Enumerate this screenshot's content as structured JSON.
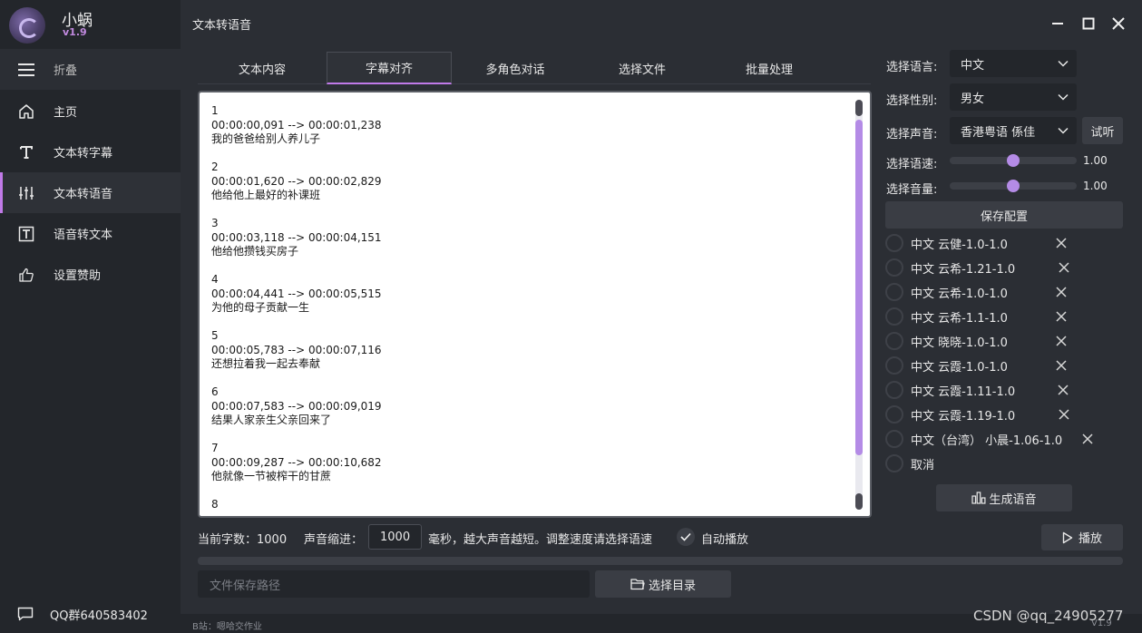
{
  "app": {
    "name": "小蜗",
    "version": "v1.9",
    "window_title": "文本转语音"
  },
  "sidebar": {
    "collapse_label": "折叠",
    "items": [
      {
        "label": "主页",
        "icon": "home-icon"
      },
      {
        "label": "文本转字幕",
        "icon": "text-t-icon"
      },
      {
        "label": "文本转语音",
        "icon": "sliders-icon",
        "active": true
      },
      {
        "label": "语音转文本",
        "icon": "text-box-icon"
      },
      {
        "label": "设置赞助",
        "icon": "thumbs-up-icon"
      }
    ],
    "qq_group": "QQ群640583402"
  },
  "tabs": [
    "文本内容",
    "字幕对齐",
    "多角色对话",
    "选择文件",
    "批量处理"
  ],
  "active_tab": "字幕对齐",
  "editor": {
    "text": "1\n00:00:00,091 --> 00:00:01,238\n我的爸爸给别人养儿子\n\n2\n00:00:01,620 --> 00:00:02,829\n他给他上最好的补课班\n\n3\n00:00:03,118 --> 00:00:04,151\n他给他攒钱买房子\n\n4\n00:00:04,441 --> 00:00:05,515\n为他的母子贡献一生\n\n5\n00:00:05,783 --> 00:00:07,116\n还想拉着我一起去奉献\n\n6\n00:00:07,583 --> 00:00:09,019\n结果人家亲生父亲回来了\n\n7\n00:00:09,287 --> 00:00:10,682\n他就像一节被榨干的甘蔗\n\n8"
  },
  "controls": {
    "char_count_label": "当前字数：1000",
    "indent_label": "声音缩进：",
    "indent_value": "1000",
    "indent_hint": "毫秒，越大声音越短。调整速度请选择语速",
    "autoplay_label": "自动播放",
    "play_label": "播放",
    "path_placeholder": "文件保存路径",
    "select_dir_label": "选择目录"
  },
  "right_panel": {
    "language_label": "选择语言:",
    "language_value": "中文",
    "gender_label": "选择性别:",
    "gender_value": "男女",
    "voice_label": "选择声音:",
    "voice_value": "香港粤语 係佳",
    "listen_label": "试听",
    "speed_label": "选择语速:",
    "speed_value": "1.00",
    "volume_label": "选择音量:",
    "volume_value": "1.00",
    "save_config_label": "保存配置",
    "presets": [
      "中文 云健-1.0-1.0",
      "中文 云希-1.21-1.0",
      "中文 云希-1.0-1.0",
      "中文 云希-1.1-1.0",
      "中文 晓晓-1.0-1.0",
      "中文 云霞-1.0-1.0",
      "中文 云霞-1.11-1.0",
      "中文 云霞-1.19-1.0",
      "中文（台湾） 小晨-1.06-1.0",
      "取消"
    ],
    "generate_label": "生成语音"
  },
  "footer": {
    "left": "B站：嗯哈交作业",
    "version": "V1.9",
    "watermark": "CSDN @qq_24905277"
  },
  "colors": {
    "accent": "#c07ae8",
    "background": "#2b2e34",
    "sidebar": "#23262b"
  }
}
